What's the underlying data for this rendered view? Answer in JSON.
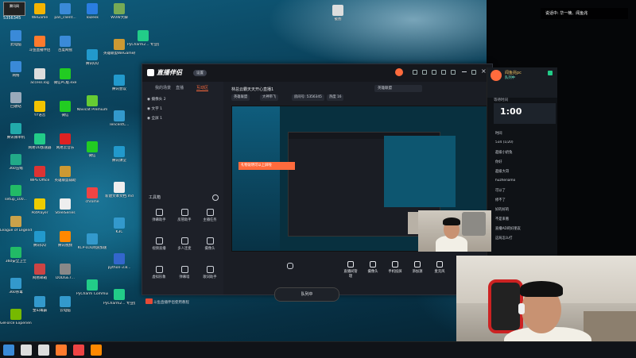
{
  "desktop": {
    "icons_col1": [
      {
        "label": "此电脑",
        "icon": "computer-icon",
        "color": "#3a8ad8"
      },
      {
        "label": "网络",
        "icon": "network-icon",
        "color": "#3a8ad8"
      },
      {
        "label": "回收站",
        "icon": "recycle-bin-icon",
        "color": "#9ab"
      },
      {
        "label": "腾讯微单机",
        "icon": "app-icon",
        "color": "#2aa"
      },
      {
        "label": "360压缩",
        "icon": "archive-icon",
        "color": "#2a8"
      },
      {
        "label": "setup_100...",
        "icon": "installer-icon",
        "color": "#2b6"
      },
      {
        "label": "League of Legends",
        "icon": "lol-icon",
        "color": "#c9a24a"
      },
      {
        "label": "360安全卫士",
        "icon": "shield-icon",
        "color": "#2b6"
      },
      {
        "label": "360杀毒",
        "icon": "antivirus-icon",
        "color": "#39c"
      },
      {
        "label": "GeForce Experience",
        "icon": "nvidia-icon",
        "color": "#76b900"
      }
    ],
    "icons_col2": [
      {
        "label": "WeGame",
        "icon": "wegame-icon",
        "color": "#f5b400"
      },
      {
        "label": "斗鱼直播伴侣",
        "icon": "douyu-icon",
        "color": "#ff7a2d"
      },
      {
        "label": "access.log",
        "icon": "file-icon",
        "color": "#ddd"
      },
      {
        "label": "YY语音",
        "icon": "yy-icon",
        "color": "#f2c300"
      },
      {
        "label": "网易UU加速器",
        "icon": "uu-icon",
        "color": "#2c8"
      },
      {
        "label": "WPS Office",
        "icon": "wps-icon",
        "color": "#d33"
      },
      {
        "label": "PotPlayer",
        "icon": "player-icon",
        "color": "#ec0"
      },
      {
        "label": "腾讯QQ",
        "icon": "qq-icon",
        "color": "#29c"
      },
      {
        "label": "网易邮箱",
        "icon": "mail-icon",
        "color": "#c44"
      },
      {
        "label": "金山毒霸",
        "icon": "duba-icon",
        "color": "#39c"
      }
    ],
    "icons_col3": [
      {
        "label": "pan_client...",
        "icon": "cloud-icon",
        "color": "#3a8ad8"
      },
      {
        "label": "百度网盘",
        "icon": "baidu-pan-icon",
        "color": "#3a8ad8"
      },
      {
        "label": "微信PC版.exe",
        "icon": "wechat-icon",
        "color": "#2c2"
      },
      {
        "label": "微信",
        "icon": "wechat-icon",
        "color": "#2c2"
      },
      {
        "label": "网易云音乐",
        "icon": "music-icon",
        "color": "#d22"
      },
      {
        "label": "英雄联盟辅助",
        "icon": "app-icon",
        "color": "#c93"
      },
      {
        "label": "SteelSeries",
        "icon": "steel-icon",
        "color": "#eee"
      },
      {
        "label": "腾讯视频",
        "icon": "video-icon",
        "color": "#f80"
      },
      {
        "label": "DODGE7...",
        "icon": "app-icon",
        "color": "#888"
      },
      {
        "label": "云电脑",
        "icon": "cloud-pc-icon",
        "color": "#39c"
      }
    ],
    "icons_col4": [
      {
        "label": "ToDesk",
        "icon": "todesk-icon",
        "color": "#2a7de1"
      },
      {
        "label": "腾讯QQ",
        "icon": "qq-icon",
        "color": "#29c"
      },
      {
        "label": "Navicat Premium",
        "icon": "navicat-icon",
        "color": "#6c3"
      },
      {
        "label": "微信",
        "icon": "wechat-icon",
        "color": "#2c2"
      },
      {
        "label": "chrome",
        "icon": "chrome-icon",
        "color": "#e44"
      },
      {
        "label": "KCP-LOL网游加速",
        "icon": "app-icon",
        "color": "#39c"
      },
      {
        "label": "PyCharm Communi...",
        "icon": "pycharm-icon",
        "color": "#2c8"
      }
    ],
    "icons_col5": [
      {
        "label": "WOW大脚",
        "icon": "wow-icon",
        "color": "#7a5"
      },
      {
        "label": "英雄联盟WeGame版",
        "icon": "app-icon",
        "color": "#c93"
      },
      {
        "label": "腾讯会议",
        "icon": "meeting-icon",
        "color": "#29c"
      },
      {
        "label": "TencentC...",
        "icon": "app-icon",
        "color": "#39c"
      },
      {
        "label": "腾讯课堂",
        "icon": "class-icon",
        "color": "#29c"
      },
      {
        "label": "新建文本文档.md",
        "icon": "text-file-icon",
        "color": "#eee"
      },
      {
        "label": "K3C",
        "icon": "app-icon",
        "color": "#39c"
      },
      {
        "label": "python-3.8...",
        "icon": "python-icon",
        "color": "#36c"
      },
      {
        "label": "PyCharm2... 专业版win...",
        "icon": "pycharm-icon",
        "color": "#2c8"
      }
    ],
    "icons_col6": [
      {
        "label": "PyCharm2... 专业版win...",
        "icon": "pycharm-icon",
        "color": "#2c8"
      }
    ],
    "icon_top_center": {
      "label": "截图",
      "icon": "image-file-icon",
      "color": "#ddd"
    },
    "top_left_label": "腾讯网",
    "top_left_number": "5356345"
  },
  "top_notice": "说话中: 华一楠、闻鱼兆",
  "app": {
    "title": "直播伴侣",
    "version_badge": "设置",
    "left_tabs": [
      {
        "label": "我的场景",
        "active": false
      },
      {
        "label": "直播",
        "active": false
      },
      {
        "label": "互动区",
        "active": true
      }
    ],
    "scenes": [
      {
        "label": "摄像头 2"
      },
      {
        "label": "文字 1"
      },
      {
        "label": "全屏 1"
      }
    ],
    "tools_title": "工具箱",
    "tools": [
      {
        "label": "弹幕助手",
        "icon": "danmaku-icon"
      },
      {
        "label": "房管助手",
        "icon": "admin-icon"
      },
      {
        "label": "主播任务",
        "icon": "task-icon"
      },
      {
        "label": "视频直播",
        "icon": "video-live-icon"
      },
      {
        "label": "多人连麦",
        "icon": "mic-link-icon"
      },
      {
        "label": "摄像头",
        "icon": "camera-icon"
      },
      {
        "label": "虚拟形象",
        "icon": "avatar-icon"
      },
      {
        "label": "弹幕墙",
        "icon": "wall-icon"
      },
      {
        "label": "歌词助手",
        "icon": "lyrics-icon"
      }
    ],
    "status_line": "斗鱼直播伴侣使用教程",
    "room_title": "林总云霸天天开心直播1",
    "category_input": "英雄联盟",
    "tags": [
      "英雄联盟",
      "大神带飞",
      "房间号: 5356345",
      "热度 16"
    ],
    "preview_banner": "礼物说明可以上屏啦",
    "bottom_tools": [
      {
        "label": "直播间管理",
        "icon": "room-icon"
      },
      {
        "label": "摄像头",
        "icon": "camera-icon"
      },
      {
        "label": "手机投屏",
        "icon": "phone-cast-icon"
      },
      {
        "label": "添加源",
        "icon": "add-source-icon"
      },
      {
        "label": "麦克风",
        "icon": "mic-icon"
      },
      {
        "label": "扬声器",
        "icon": "speaker-icon"
      }
    ],
    "queue_button": "队列中"
  },
  "chat": {
    "name": "闻鱼兆pc",
    "sub": "队列中",
    "section_label": "等待时间",
    "timer": "1:00",
    "lines": [
      "时间",
      "534 (1/20)",
      "超级小奶兔",
      "你好",
      "超级大哥",
      "huzhenamo",
      "可以了",
      "修不了",
      "好的好的",
      "不是来看",
      "直播AD的好朋友",
      "这局怎么打"
    ]
  },
  "taskbar": {
    "items": [
      {
        "icon": "windows-start-icon",
        "color": "#3a8ad8"
      },
      {
        "icon": "search-icon",
        "color": "#ddd"
      },
      {
        "icon": "task-view-icon",
        "color": "#ddd"
      },
      {
        "icon": "douyu-icon",
        "color": "#ff7a2d"
      },
      {
        "icon": "chrome-icon",
        "color": "#e44"
      },
      {
        "icon": "app-icon",
        "color": "#f80"
      }
    ]
  }
}
